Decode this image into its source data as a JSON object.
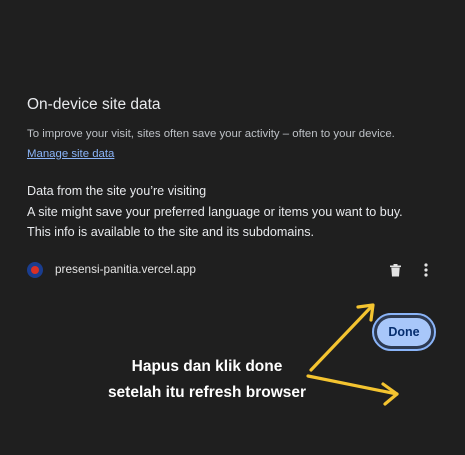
{
  "dialog": {
    "title": "On-device site data",
    "description": "To improve your visit, sites often save your activity – often to your device.",
    "manage_link": "Manage site data",
    "section_heading": "Data from the site you’re visiting",
    "section_line_1": "A site might save your preferred language or items you want to buy.",
    "section_line_2": "This info is available to the site and its subdomains.",
    "site": {
      "name": "presensi-panitia.vercel.app",
      "favicon_icon": "site-favicon-icon",
      "delete_icon": "trash-icon",
      "more_icon": "more-vert-icon"
    },
    "done_label": "Done"
  },
  "annotation": {
    "line_1": "Hapus dan klik done",
    "line_2": "setelah itu refresh browser",
    "color": "#ffffff",
    "arrow_color": "#f4c430"
  },
  "colors": {
    "background": "#1f1f1f",
    "link": "#8ab4f8",
    "done_button": "#a8c7fa"
  }
}
